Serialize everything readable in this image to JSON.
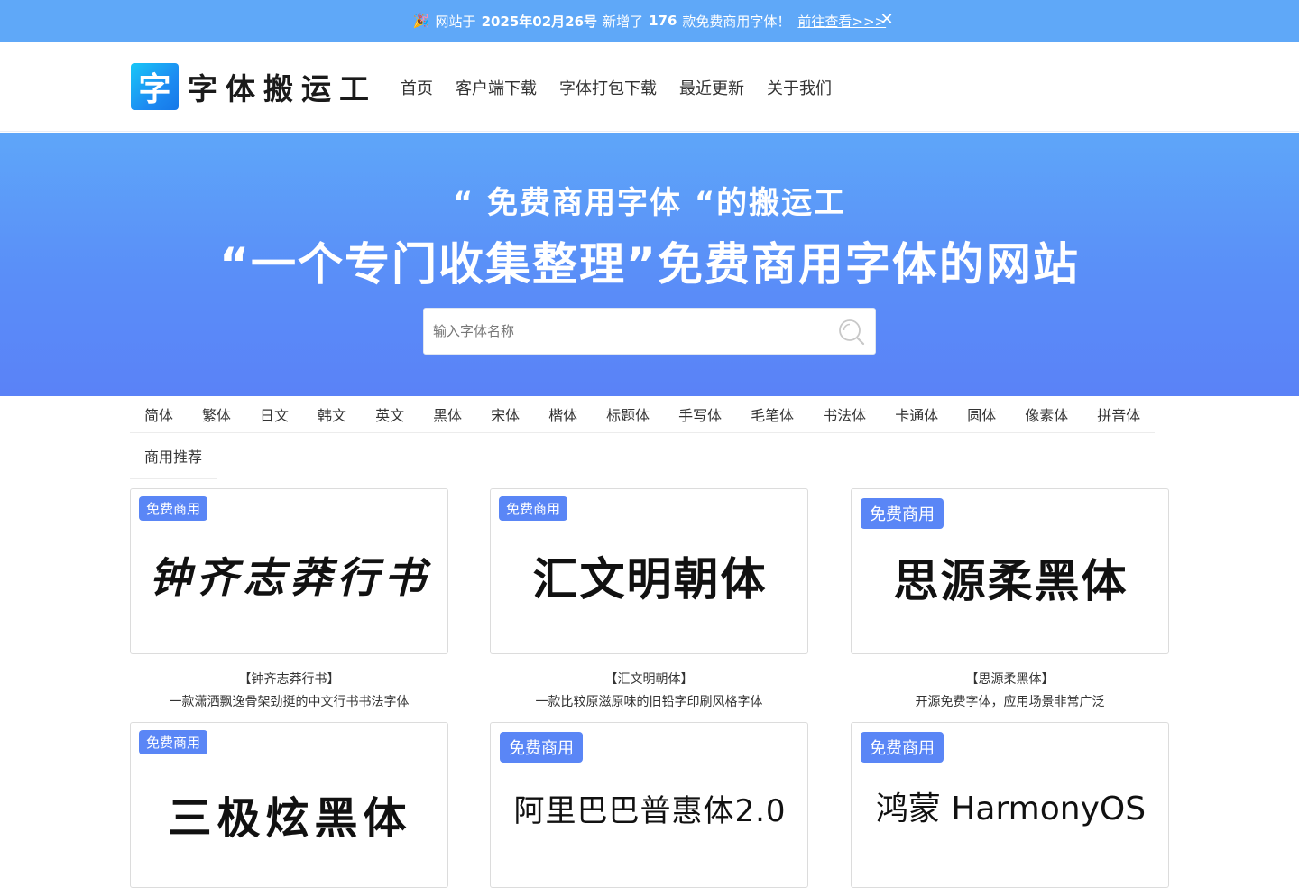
{
  "announcement": {
    "party_icon": "party-popper-icon",
    "prefix": "网站于",
    "date": "2025年02月26号",
    "middle": "新增了",
    "count": "176",
    "suffix": "款免费商用字体！",
    "link": "前往查看>>>",
    "close": "✕"
  },
  "header": {
    "logo_mark": "字",
    "logo_name": "字体搬运工",
    "nav": [
      "首页",
      "客户端下载",
      "字体打包下载",
      "最近更新",
      "关于我们"
    ]
  },
  "hero": {
    "line1": "“ 免费商用字体 “的搬运工",
    "line2": "“一个专门收集整理”免费商用字体的网站",
    "search_placeholder": "输入字体名称"
  },
  "categories": {
    "row1": [
      "简体",
      "繁体",
      "日文",
      "韩文",
      "英文",
      "黑体",
      "宋体",
      "楷体",
      "标题体",
      "手写体",
      "毛笔体",
      "书法体",
      "卡通体",
      "圆体",
      "像素体",
      "拼音体"
    ],
    "row2": [
      "商用推荐"
    ]
  },
  "cards": [
    {
      "badge": "免费商用",
      "sample": "钟齐志莽行书",
      "title": "【钟齐志莽行书】",
      "desc": "一款潇洒飘逸骨架劲挺的中文行书书法字体"
    },
    {
      "badge": "免费商用",
      "sample": "汇文明朝体",
      "title": "【汇文明朝体】",
      "desc": "一款比较原滋原味的旧铅字印刷风格字体"
    },
    {
      "badge": "免费商用",
      "sample": "思源柔黑体",
      "title": "【思源柔黑体】",
      "desc": "开源免费字体，应用场景非常广泛"
    },
    {
      "badge": "免费商用",
      "sample": "三极炫黑体",
      "title": "",
      "desc": ""
    },
    {
      "badge": "免费商用",
      "sample": "阿里巴巴普惠体2.0",
      "title": "",
      "desc": ""
    },
    {
      "badge": "免费商用",
      "sample": "鸿蒙 HarmonyOS",
      "title": "",
      "desc": ""
    }
  ],
  "colors": {
    "announce_bg": "#5fa8f8",
    "hero_top": "#5ea6f9",
    "hero_bottom": "#5a82f7",
    "badge": "#5a86f6"
  }
}
